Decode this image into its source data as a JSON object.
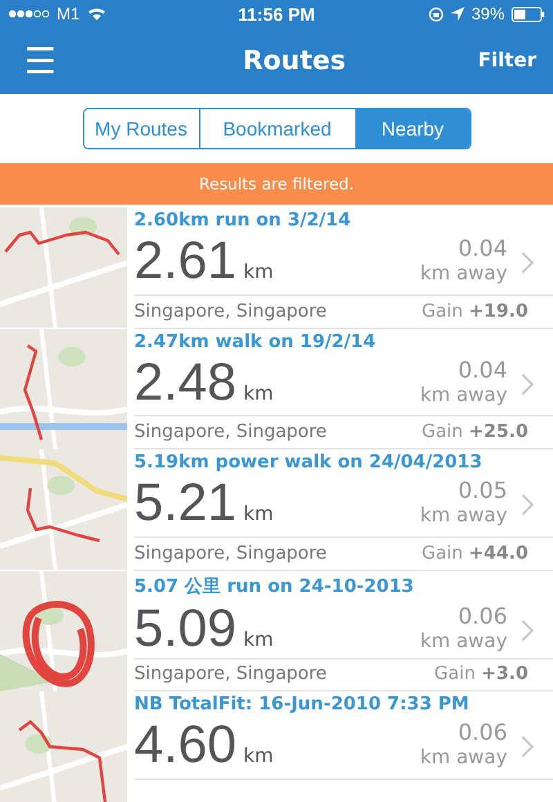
{
  "status_bar": {
    "carrier": "M1",
    "time": "11:56 PM",
    "battery": "39%"
  },
  "nav": {
    "menu_icon": "☰",
    "title": "Routes",
    "action": "Filter"
  },
  "tabs": [
    {
      "label": "My Routes",
      "selected": false
    },
    {
      "label": "Bookmarked",
      "selected": false
    },
    {
      "label": "Nearby",
      "selected": true
    }
  ],
  "banner": "Results are filtered.",
  "routes": [
    {
      "title": "2.60km run on 3/2/14",
      "distance": "2.61",
      "unit": "km",
      "away": "0.04",
      "away_label": "km away",
      "location": "Singapore, Singapore",
      "gain_label": "Gain",
      "gain": "+19.0"
    },
    {
      "title": "2.47km walk on 19/2/14",
      "distance": "2.48",
      "unit": "km",
      "away": "0.04",
      "away_label": "km away",
      "location": "Singapore, Singapore",
      "gain_label": "Gain",
      "gain": "+25.0"
    },
    {
      "title": "5.19km power walk on 24/04/2013",
      "distance": "5.21",
      "unit": "km",
      "away": "0.05",
      "away_label": "km away",
      "location": "Singapore, Singapore",
      "gain_label": "Gain",
      "gain": "+44.0"
    },
    {
      "title": "5.07 公里 run on 24-10-2013",
      "distance": "5.09",
      "unit": "km",
      "away": "0.06",
      "away_label": "km away",
      "location": "Singapore, Singapore",
      "gain_label": "Gain",
      "gain": "+3.0"
    },
    {
      "title": "NB TotalFit: 16-Jun-2010 7:33 PM",
      "distance": "4.60",
      "unit": "km",
      "away": "0.06",
      "away_label": "km away"
    }
  ]
}
